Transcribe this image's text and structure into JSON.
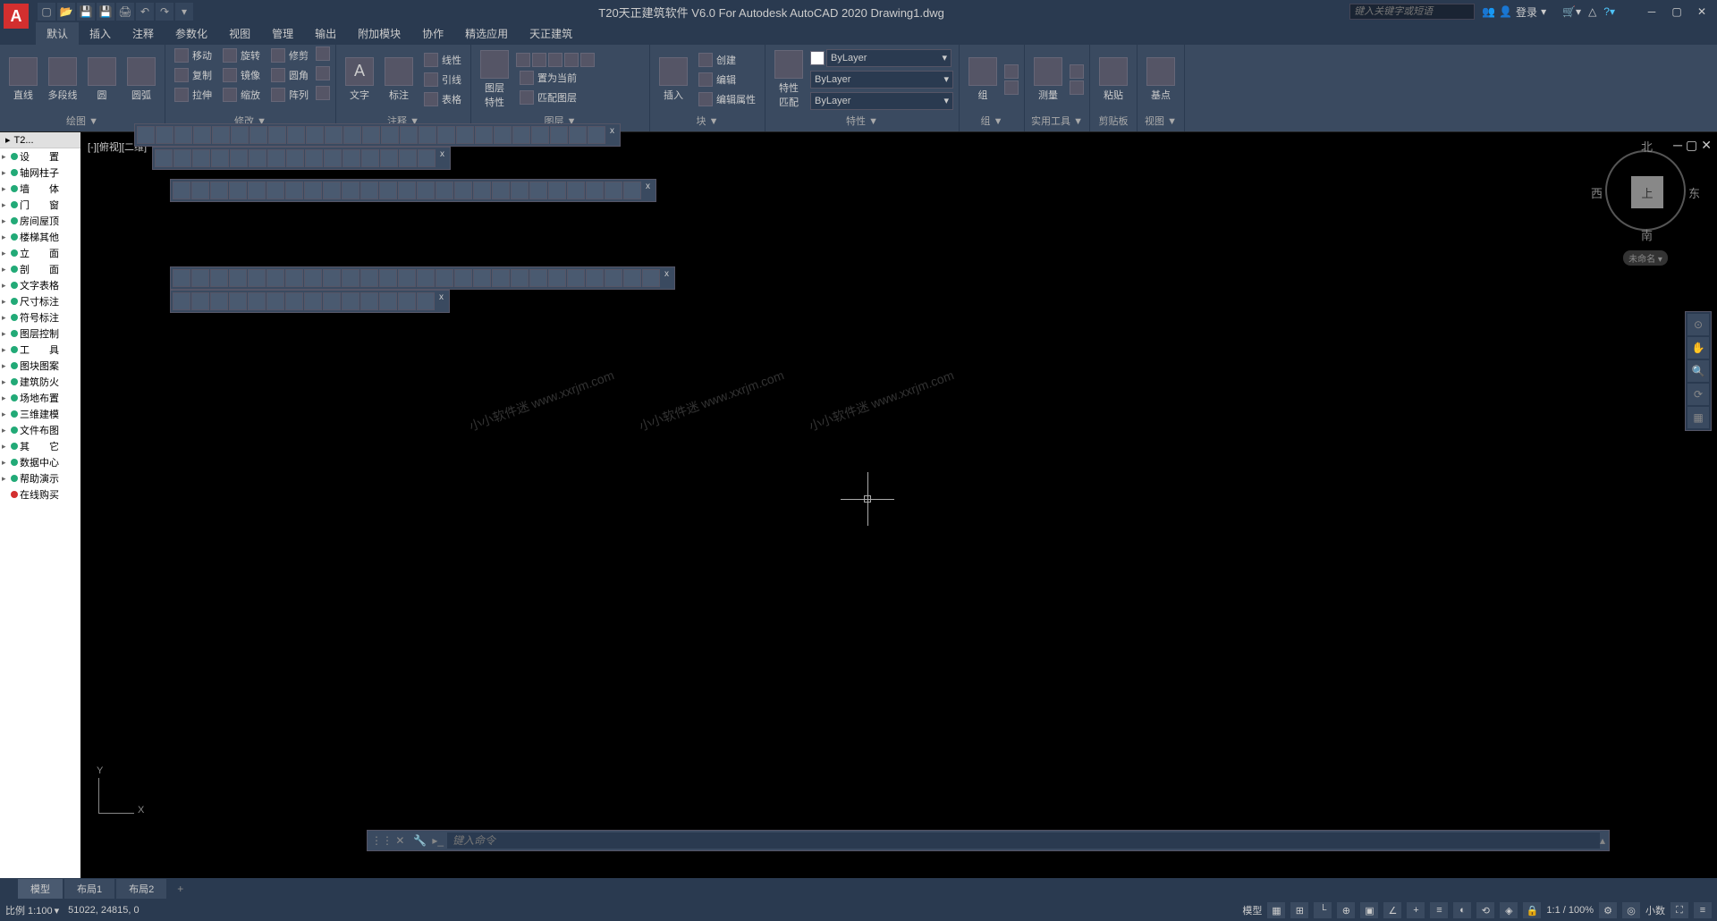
{
  "titlebar": {
    "logo": "A",
    "title": "T20天正建筑软件 V6.0 For Autodesk AutoCAD 2020   Drawing1.dwg",
    "search_placeholder": "键入关键字或短语",
    "login_label": "登录",
    "share_icon": "⇄",
    "cloud_icon": "△"
  },
  "ribbon_tabs": [
    "默认",
    "插入",
    "注释",
    "参数化",
    "视图",
    "管理",
    "输出",
    "附加模块",
    "协作",
    "精选应用",
    "天正建筑"
  ],
  "ribbon_active_tab": "默认",
  "ribbon_panels": {
    "draw": {
      "title": "绘图 ▼",
      "buttons": [
        "直线",
        "多段线",
        "圆",
        "圆弧"
      ]
    },
    "modify": {
      "title": "修改 ▼",
      "rows": [
        [
          "移动",
          "旋转",
          "修剪"
        ],
        [
          "复制",
          "镜像",
          "圆角"
        ],
        [
          "拉伸",
          "缩放",
          "阵列"
        ]
      ]
    },
    "annotation": {
      "title": "注释 ▼",
      "buttons": [
        "文字",
        "标注"
      ],
      "rows": [
        "线性",
        "引线",
        "表格"
      ]
    },
    "layers": {
      "title": "图层 ▼",
      "button": "图层\n特性",
      "match": "置为当前",
      "match2": "匹配图层"
    },
    "block": {
      "title": "块 ▼",
      "button": "插入",
      "rows": [
        "创建",
        "编辑",
        "编辑属性"
      ]
    },
    "properties": {
      "title": "特性 ▼",
      "button": "特性\n匹配",
      "bylayer": "ByLayer"
    },
    "groups": {
      "title": "组 ▼",
      "button": "组"
    },
    "utilities": {
      "title": "实用工具 ▼",
      "button": "测量"
    },
    "clipboard": {
      "title": "剪贴板",
      "button": "粘贴"
    },
    "view": {
      "title": "视图 ▼",
      "button": "基点"
    }
  },
  "left_panel": {
    "tab": "T2...",
    "items": [
      {
        "label": "设　　置"
      },
      {
        "label": "轴网柱子"
      },
      {
        "label": "墙　　体"
      },
      {
        "label": "门　　窗"
      },
      {
        "label": "房间屋顶"
      },
      {
        "label": "楼梯其他"
      },
      {
        "label": "立　　面"
      },
      {
        "label": "剖　　面"
      },
      {
        "label": "文字表格"
      },
      {
        "label": "尺寸标注"
      },
      {
        "label": "符号标注"
      },
      {
        "label": "图层控制"
      },
      {
        "label": "工　　具"
      },
      {
        "label": "图块图案"
      },
      {
        "label": "建筑防火"
      },
      {
        "label": "场地布置"
      },
      {
        "label": "三维建模"
      },
      {
        "label": "文件布图"
      },
      {
        "label": "其　　它"
      },
      {
        "label": "数据中心"
      },
      {
        "label": "帮助演示"
      },
      {
        "label": "在线购买"
      }
    ]
  },
  "drawing": {
    "view_label": "[-][俯视][二维]",
    "viewcube": {
      "top": "上",
      "north": "北",
      "south": "南",
      "east": "东",
      "west": "西",
      "wcs": "未命名 ▾"
    },
    "ucs": {
      "x": "X",
      "y": "Y"
    },
    "command_placeholder": "键入命令",
    "watermark": "小小软件迷 www.xxrjm.com"
  },
  "bottom_tabs": [
    "模型",
    "布局1",
    "布局2"
  ],
  "status_bar": {
    "scale_label": "比例 1:100",
    "coords": "51022, 24815, 0",
    "model": "模型",
    "zoom": "1:1 / 100%",
    "decimal": "小数"
  }
}
